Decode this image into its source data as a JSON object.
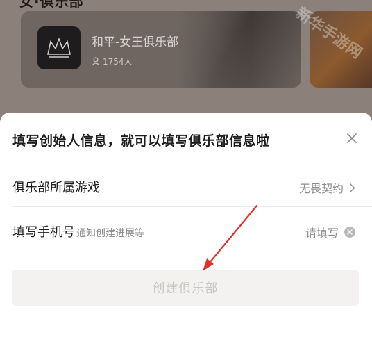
{
  "background": {
    "header_text": "女·俱乐部",
    "club_card": {
      "name": "和平-女王俱乐部",
      "members": "1754人"
    },
    "watermark_text": "新华手游网"
  },
  "sheet": {
    "title": "填写创始人信息，就可以填写俱乐部信息啦",
    "rows": [
      {
        "label": "俱乐部所属游戏",
        "hint": "",
        "value": "无畏契约"
      },
      {
        "label": "填写手机号",
        "hint": "通知创建进展等",
        "value": "请填写"
      }
    ],
    "submit_label": "创建俱乐部"
  },
  "colors": {
    "annotation_arrow": "#e0302a",
    "submit_disabled_bg": "#f4f2f0"
  }
}
